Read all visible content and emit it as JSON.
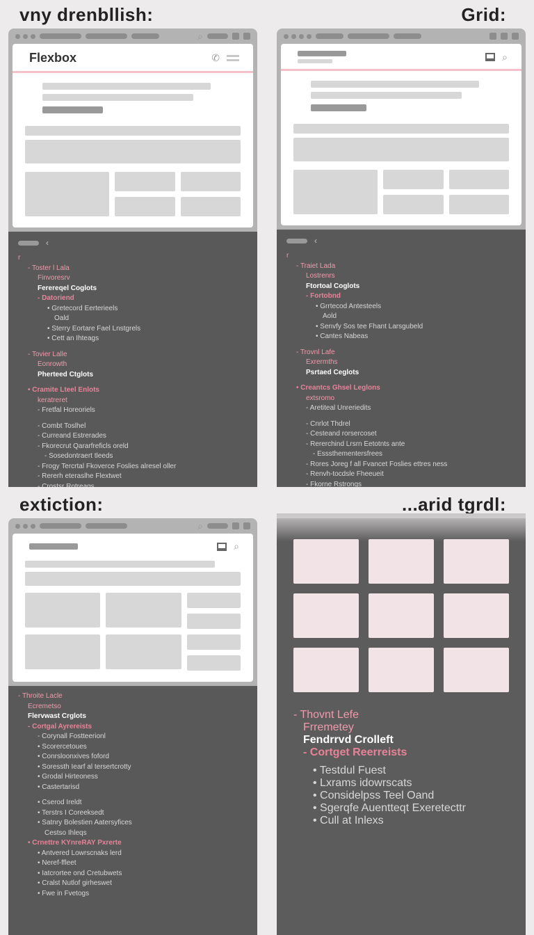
{
  "quadrants": {
    "q1": {
      "title": "vny drenbllish:",
      "brand": "Flexbox"
    },
    "q2": {
      "title": "Grid:"
    },
    "q3": {
      "title": "extiction:"
    },
    "q4": {
      "title": "...arid tgrdl:"
    }
  },
  "code1": {
    "g1": {
      "h1": "Toster l Lala",
      "h2": "Finvoresrv",
      "h3": "Ferereqel Coglots",
      "h4": "Datoriend",
      "items": [
        "Gretecord Eerterieels",
        "Oald",
        "Sterry Eortare Fael Lnstgrels",
        "Cett an Ihteags"
      ]
    },
    "g2": {
      "h1": "Tovier Lalle",
      "h2": "Eonrowth",
      "h3": "Pherteed Ctglots"
    },
    "g3": {
      "h1": "Cramite Lteel Enlots",
      "sub": "keratreret",
      "sub2": "Fretfal Horeoriels",
      "items": [
        "Combt Toslhel",
        "Curreand Estrerades",
        "Fkorecrut Qararfreficls oreld",
        "Sosedontraert tleeds",
        "Frogy Tercrtal Fkoverce Foslies alresel oller",
        "Rererh eteraslhe Flextwet",
        "Crostsr Rotreags"
      ]
    }
  },
  "code2": {
    "g1": {
      "h1": "Traiet Lada",
      "h2": "Lostrenrs",
      "h3": "Ftortoal Coglots",
      "h4": "Fortobnd",
      "items": [
        "Grrtecod Antesteels",
        "Aold",
        "Senvfy Sos tee Fhant Larsgubeld",
        "Cantes Nabeas"
      ]
    },
    "g2": {
      "h1": "Trovnl Lafe",
      "h2": "Exrermths",
      "h3": "Psrtaed Ceglots"
    },
    "g3": {
      "h1": "Creantcs Ghsel Leglons",
      "sub": "extsromo",
      "sub2": "Aretiteal Unreriedits",
      "items": [
        "Cnrlot Thdrel",
        "Cesteand rorsercoset",
        "Rererchind Lrsrn Eetotnts ante",
        "Esssthementersfrees",
        "Rores Joreg f all Fvancet Foslies ettres ness",
        "Renvh-tocdsle Fheeueit",
        "Fkorne Rstrongs"
      ]
    }
  },
  "code3": {
    "g1": {
      "h1": "Throite Lacle",
      "h2": "Ecremetso",
      "h3": "Flervwast Crglots",
      "h4": "Cortgal Ayrereists",
      "items": [
        "Corynall Fostteerionl",
        "Scorercetoues",
        "Conrsloonxives foford",
        "Soressth   Iearf al tersertcrotty",
        "Grodal Hirteoness",
        "Castertarisd",
        "Cserod Ireldt",
        "Terstrs I Coreeksedt",
        "Satnry Bolestien Aatersyfices",
        "Cestso Ihleqs"
      ]
    },
    "g2": {
      "h1": "Crnettre KYnreRAY Pxrerte",
      "items": [
        "Antvered Lowrscnaks lerd",
        "Neref-ffleet",
        "Iatcrortee ond Cretubwets",
        "Cralst Nutlof girheswet",
        "Fwe in Fvetogs"
      ]
    }
  },
  "code4": {
    "g1": {
      "h1": "Thovnt Lefe",
      "h2": "Frremetey",
      "h3": "Fendrrvd Crolleft",
      "h4": "Cortget Reerreists",
      "items": [
        "Testdul Fuest",
        "Lxrams idowrscats",
        "Considelpss Teel Oand",
        "Sgerqfe Auentteqt Exeretecttr",
        "Cull at Inlexs"
      ]
    }
  }
}
